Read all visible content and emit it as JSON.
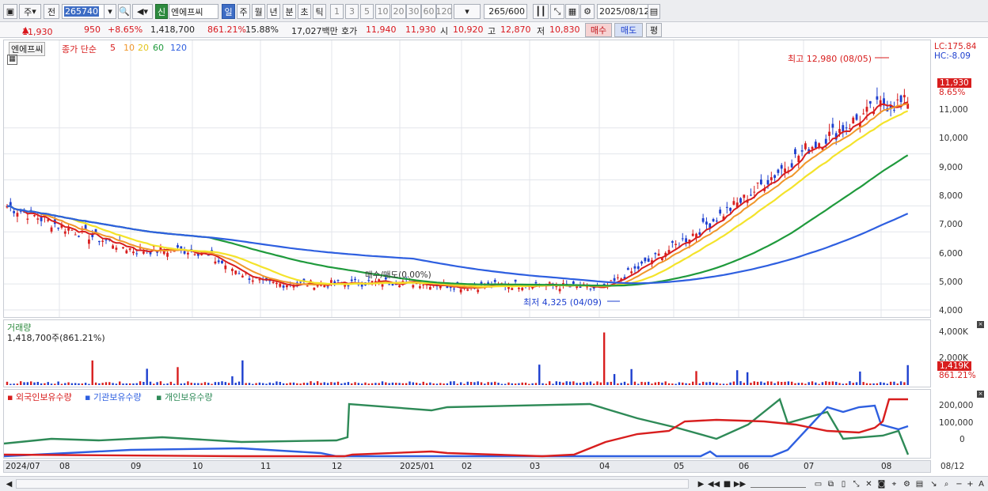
{
  "toolbar": {
    "period_label": "주",
    "prev_label": "전",
    "code_value": "265740",
    "stock_badge": "신",
    "stock_name": "엔에프씨",
    "intervals": [
      "일",
      "주",
      "월",
      "년",
      "분",
      "초",
      "틱"
    ],
    "active_interval": "일",
    "minute_steps": [
      "1",
      "3",
      "5",
      "10",
      "20",
      "30",
      "60",
      "120"
    ],
    "count_value": "265/600",
    "date_value": "2025/08/12"
  },
  "quote": {
    "price": "11,930",
    "change": "950",
    "change_pct": "+8.65%",
    "volume": "1,418,700",
    "volume_ratio": "861.21%",
    "turnover": "15.88%",
    "amount": "17,027백만",
    "hoga_label": "호가",
    "ask": "11,940",
    "bid": "11,930",
    "open_label": "시",
    "open": "10,920",
    "high_label": "고",
    "high": "12,870",
    "low_label": "저",
    "low": "10,830",
    "buy_label": "매수",
    "sell_label": "매도",
    "eval_label": "평"
  },
  "price_pane": {
    "title": "엔에프씨",
    "ma_label": "종가 단순",
    "ma_periods": [
      "5",
      "10",
      "20",
      "60",
      "120"
    ],
    "ma_colors": [
      "#d81e1e",
      "#f0962a",
      "#f4e32b",
      "#1f9a3c",
      "#2e5fe0"
    ],
    "lc_label": "LC:175.84",
    "hc_label": "HC:-8.09",
    "current_tag": "11,930",
    "current_pct": "8.65%",
    "high_note": "최고 12,980 (08/05)",
    "low_note": "최저 4,325 (04/09)",
    "overlay_label": "매수/매도(0.00%)",
    "y_ticks": [
      "11,000",
      "10,000",
      "9,000",
      "8,000",
      "7,000",
      "6,000",
      "5,000",
      "4,000"
    ]
  },
  "volume_pane": {
    "title": "거래량",
    "value_text": "1,418,700주(861.21%)",
    "y_ticks": [
      "4,000K",
      "2,000K"
    ],
    "current_tag": "1,419K",
    "current_pct": "861.21%"
  },
  "holding_pane": {
    "legend": [
      "외국인보유수량",
      "기관보유수량",
      "개인보유수량"
    ],
    "legend_colors": [
      "#d81e1e",
      "#2e5fe0",
      "#2e8a57"
    ],
    "y_ticks": [
      "200,000",
      "100,000",
      "0"
    ]
  },
  "x_axis": {
    "labels": [
      "2024/07",
      "08",
      "09",
      "10",
      "11",
      "12",
      "2025/01",
      "02",
      "03",
      "04",
      "05",
      "06",
      "07",
      "08"
    ],
    "right_label": "08/12"
  },
  "chart_data": {
    "type": "candlestick",
    "title": "엔에프씨",
    "ylim": [
      4000,
      13000
    ],
    "monthly_close_approx": [
      {
        "month": "2024/07",
        "price": 8000
      },
      {
        "month": "08",
        "price": 7200
      },
      {
        "month": "09",
        "price": 6300
      },
      {
        "month": "10",
        "price": 6300
      },
      {
        "month": "11",
        "price": 5000
      },
      {
        "month": "12",
        "price": 5000
      },
      {
        "month": "2025/01",
        "price": 5100
      },
      {
        "month": "02",
        "price": 4900
      },
      {
        "month": "03",
        "price": 5000
      },
      {
        "month": "04",
        "price": 4800
      },
      {
        "month": "05",
        "price": 6500
      },
      {
        "month": "06",
        "price": 8200
      },
      {
        "month": "07",
        "price": 10200
      },
      {
        "month": "08",
        "price": 11930
      }
    ],
    "max_high": 12980,
    "max_high_date": "08/05",
    "min_low": 4325,
    "min_low_date": "04/09"
  }
}
